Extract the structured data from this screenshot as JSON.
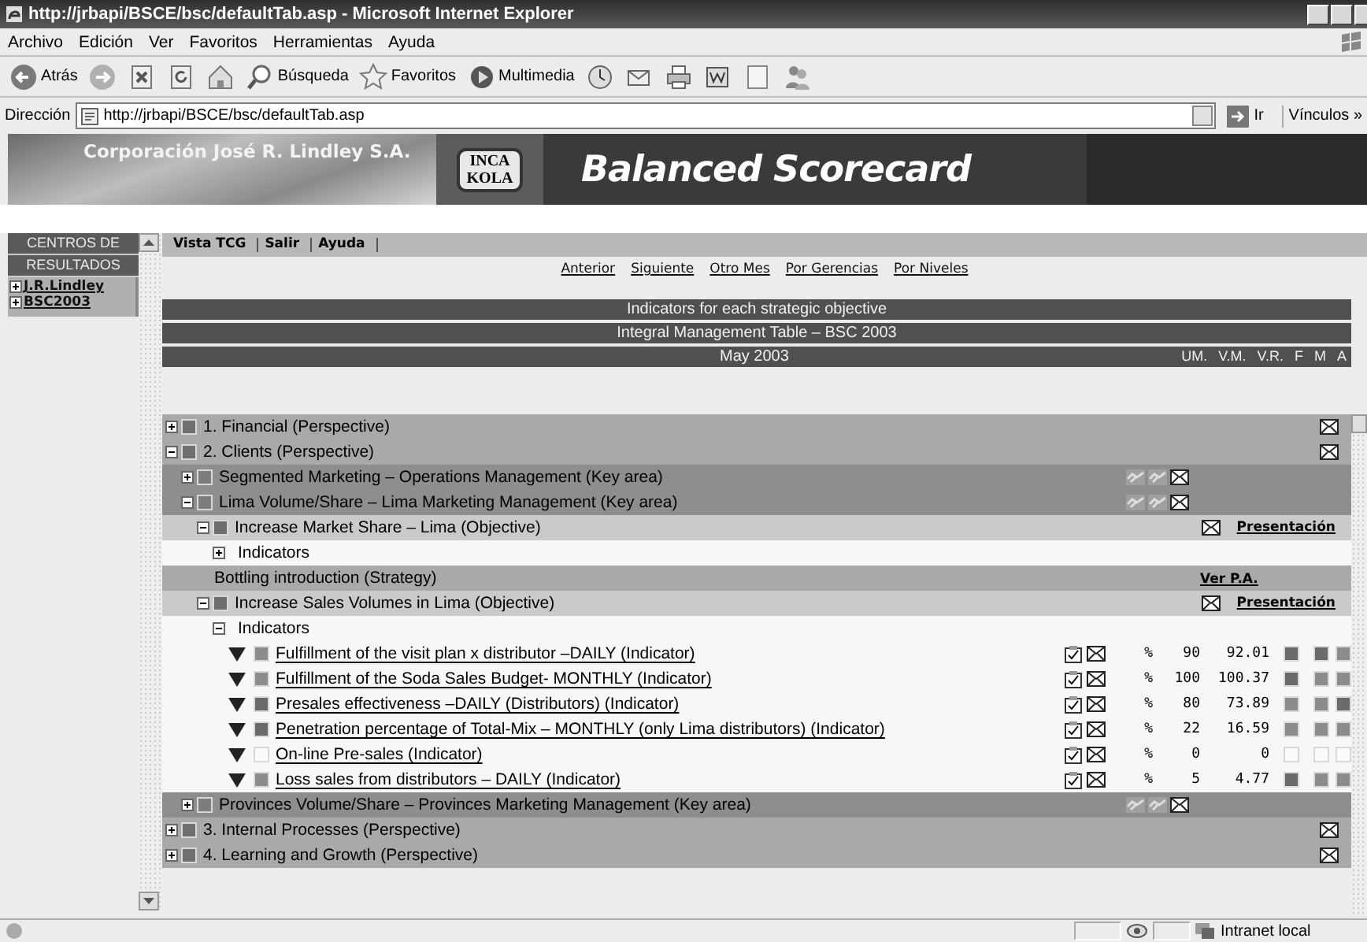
{
  "window": {
    "title": "http://jrbapi/BSCE/bsc/defaultTab.asp - Microsoft Internet Explorer"
  },
  "menu": [
    "Archivo",
    "Edición",
    "Ver",
    "Favoritos",
    "Herramientas",
    "Ayuda"
  ],
  "toolbar": [
    {
      "kind": "back",
      "label": "Atrás"
    },
    {
      "kind": "forward"
    },
    {
      "kind": "stop"
    },
    {
      "kind": "refresh"
    },
    {
      "kind": "home"
    },
    {
      "kind": "search",
      "label": "Búsqueda"
    },
    {
      "kind": "favorites",
      "label": "Favoritos"
    },
    {
      "kind": "media",
      "label": "Multimedia"
    },
    {
      "kind": "history"
    },
    {
      "kind": "mail"
    },
    {
      "kind": "print"
    },
    {
      "kind": "word"
    },
    {
      "kind": "note"
    },
    {
      "kind": "messenger"
    }
  ],
  "address": {
    "label": "Dirección",
    "value": "http://jrbapi/BSCE/bsc/defaultTab.asp",
    "go": "Ir",
    "links": "Vínculos",
    "more": "»"
  },
  "banner": {
    "company": "Corporación José R. Lindley S.A.",
    "logo": [
      "INCA",
      "KOLA"
    ],
    "title": "Balanced Scorecard"
  },
  "sidebar": {
    "heading": [
      "CENTROS DE",
      "RESULTADOS"
    ],
    "items": [
      {
        "label": "J.R.Lindley",
        "expanded": false
      },
      {
        "label": "BSC2003",
        "expanded": false
      }
    ]
  },
  "nav": [
    "Vista TCG",
    "Salir",
    "Ayuda"
  ],
  "links": [
    "Anterior",
    "Siguiente",
    "Otro Mes",
    "Por Gerencias",
    "Por Niveles"
  ],
  "headers": [
    "Indicators for each strategic objective",
    "Integral Management Table – BSC 2003"
  ],
  "month": "May 2003",
  "columns": [
    "UM.",
    "V.M.",
    "V.R.",
    "F",
    "M",
    "A"
  ],
  "tree": [
    {
      "kind": "perspective",
      "label": "1. Financial (Perspective)",
      "expanded": false,
      "color": "#707070"
    },
    {
      "kind": "perspective",
      "label": "2. Clients (Perspective)",
      "expanded": true,
      "color": "#707070",
      "children": [
        {
          "kind": "key_area",
          "label": "Segmented Marketing – Operations Management (Key area)",
          "expanded": false,
          "color": "#7c7c7c"
        },
        {
          "kind": "key_area",
          "label": "Lima Volume/Share – Lima Marketing Management (Key area)",
          "expanded": true,
          "color": "#7c7c7c",
          "children": [
            {
              "kind": "objective",
              "label": "Increase Market Share – Lima (Objective)",
              "expanded": true,
              "color": "#6e6e6e",
              "link": "Presentación",
              "children": [
                {
                  "kind": "group",
                  "label": "Indicators",
                  "expanded": false
                }
              ]
            },
            {
              "kind": "strategy",
              "label": "Bottling introduction (Strategy)",
              "link": "Ver P.A."
            },
            {
              "kind": "objective",
              "label": "Increase Sales Volumes in Lima (Objective)",
              "expanded": true,
              "color": "#6e6e6e",
              "link": "Presentación",
              "children": [
                {
                  "kind": "group",
                  "label": "Indicators",
                  "expanded": true,
                  "children": [
                    {
                      "kind": "indicator",
                      "label": "Fulfillment of the visit plan x distributor –DAILY (Indicator)",
                      "color": "#8c8c8c",
                      "unit": "%",
                      "target": "90",
                      "actual": "92.01",
                      "flags": [
                        {
                          "color": "#6a6a6a"
                        },
                        {
                          "color": "#6a6a6a"
                        },
                        {
                          "color": "#8c8c8c"
                        }
                      ]
                    },
                    {
                      "kind": "indicator",
                      "label": "Fulfillment of the Soda Sales Budget- MONTHLY (Indicator)",
                      "color": "#8c8c8c",
                      "unit": "%",
                      "target": "100",
                      "actual": "100.37",
                      "flags": [
                        {
                          "color": "#6a6a6a"
                        },
                        {
                          "color": "#8c8c8c"
                        },
                        {
                          "color": "#8c8c8c"
                        }
                      ]
                    },
                    {
                      "kind": "indicator",
                      "label": "Presales effectiveness –DAILY (Distributors) (Indicator)",
                      "color": "#6a6a6a",
                      "unit": "%",
                      "target": "80",
                      "actual": "73.89",
                      "flags": [
                        {
                          "color": "#8c8c8c"
                        },
                        {
                          "color": "#8c8c8c"
                        },
                        {
                          "color": "#6a6a6a"
                        }
                      ]
                    },
                    {
                      "kind": "indicator",
                      "label": "Penetration percentage of Total-Mix – MONTHLY (only Lima distributors) (Indicator)",
                      "color": "#6a6a6a",
                      "unit": "%",
                      "target": "22",
                      "actual": "16.59",
                      "flags": [
                        {
                          "color": "#8c8c8c"
                        },
                        {
                          "color": "#8c8c8c"
                        },
                        {
                          "color": "#8c8c8c"
                        }
                      ]
                    },
                    {
                      "kind": "indicator",
                      "label": "On-line Pre-sales (Indicator)",
                      "color": "#fafafa",
                      "unit": "%",
                      "target": "0",
                      "actual": "0",
                      "flags": [
                        {
                          "color": "#fafafa"
                        },
                        {
                          "color": "#fafafa"
                        },
                        {
                          "color": "#fafafa"
                        }
                      ]
                    },
                    {
                      "kind": "indicator",
                      "label": "Loss sales from distributors – DAILY (Indicator)",
                      "color": "#8c8c8c",
                      "unit": "%",
                      "target": "5",
                      "actual": "4.77",
                      "flags": [
                        {
                          "color": "#6a6a6a"
                        },
                        {
                          "color": "#8c8c8c"
                        },
                        {
                          "color": "#8c8c8c"
                        }
                      ]
                    }
                  ]
                }
              ]
            }
          ]
        },
        {
          "kind": "key_area",
          "label": "Provinces Volume/Share – Provinces Marketing Management (Key area)",
          "expanded": false,
          "color": "#7c7c7c"
        }
      ]
    },
    {
      "kind": "perspective",
      "label": "3. Internal Processes (Perspective)",
      "expanded": false,
      "color": "#707070"
    },
    {
      "kind": "perspective",
      "label": "4. Learning and Growth (Perspective)",
      "expanded": false,
      "color": "#707070"
    }
  ],
  "status_bar": {
    "zone": "Intranet local"
  }
}
